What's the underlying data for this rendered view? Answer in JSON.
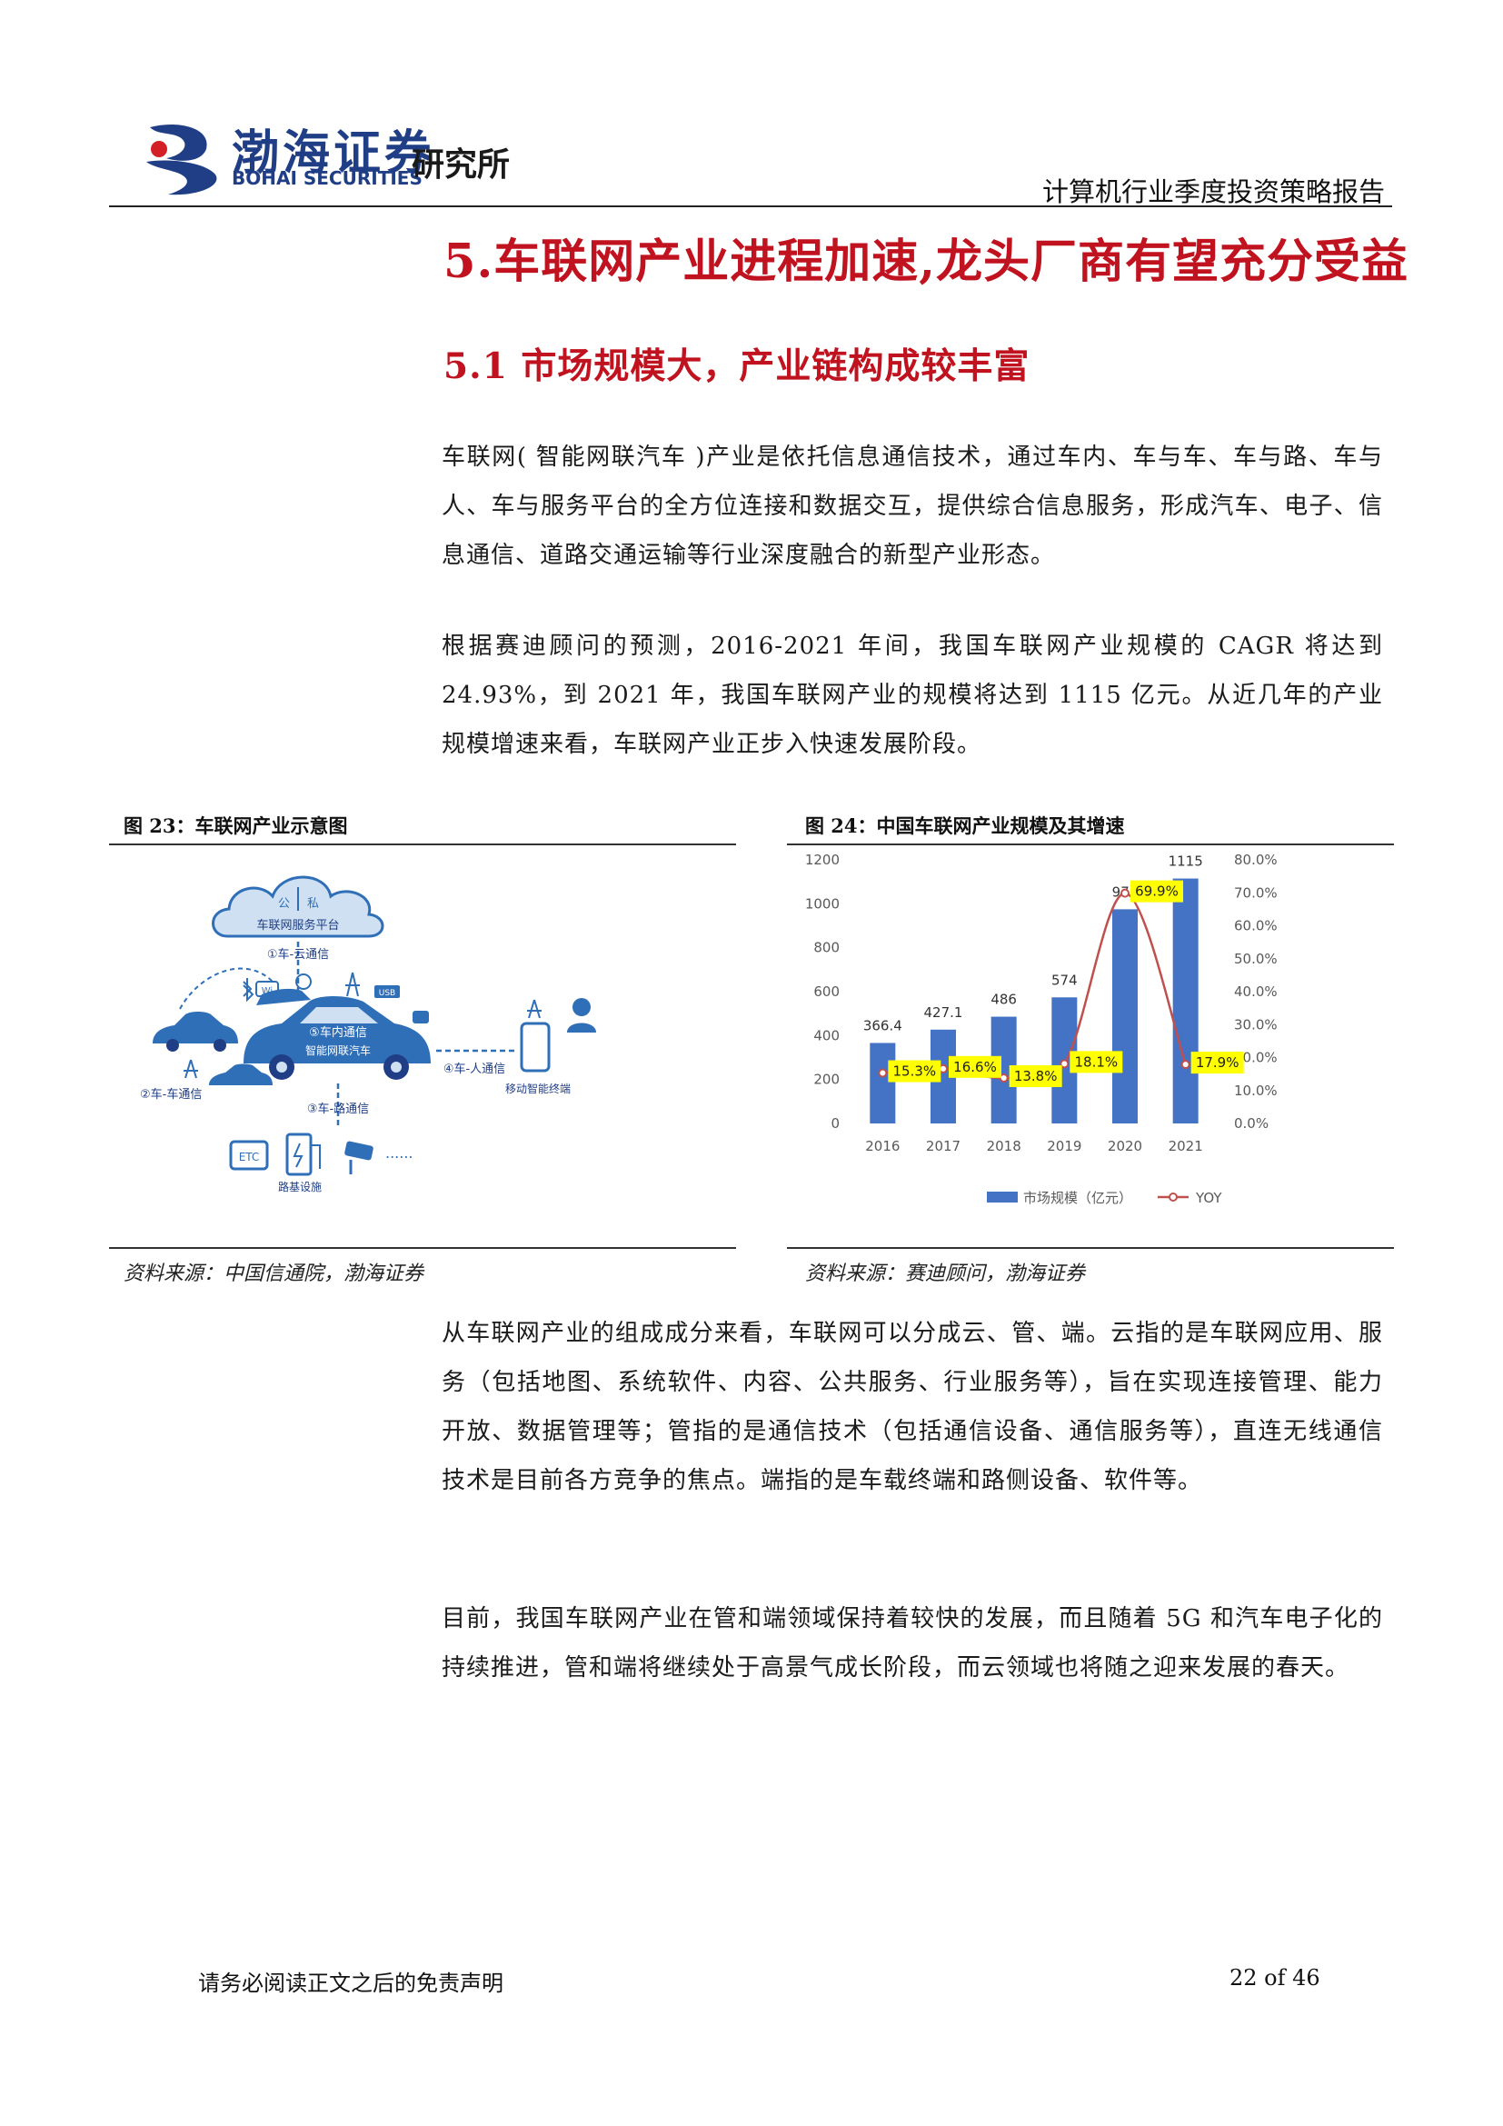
{
  "header": {
    "brand_cn": "渤海证券",
    "brand_en": "BOHAI SECURITIES",
    "brand_institute": "研究所",
    "report_title": "计算机行业季度投资策略报告"
  },
  "section": {
    "heading": "5.车联网产业进程加速,龙头厂商有望充分受益",
    "subheading": "5.1 市场规模大，产业链构成较丰富"
  },
  "paragraphs": {
    "p1": "车联网( 智能网联汽车 )产业是依托信息通信技术，通过车内、车与车、车与路、车与人、车与服务平台的全方位连接和数据交互，提供综合信息服务，形成汽车、电子、信息通信、道路交通运输等行业深度融合的新型产业形态。",
    "p2": "根据赛迪顾问的预测，2016-2021 年间，我国车联网产业规模的 CAGR 将达到 24.93%，到 2021 年，我国车联网产业的规模将达到 1115 亿元。从近几年的产业规模增速来看，车联网产业正步入快速发展阶段。",
    "p3": "从车联网产业的组成成分来看，车联网可以分成云、管、端。云指的是车联网应用、服务（包括地图、系统软件、内容、公共服务、行业服务等），旨在实现连接管理、能力开放、数据管理等；管指的是通信技术（包括通信设备、通信服务等），直连无线通信技术是目前各方竞争的焦点。端指的是车载终端和路侧设备、软件等。",
    "p4": "目前，我国车联网产业在管和端领域保持着较快的发展，而且随着 5G 和汽车电子化的持续推进，管和端将继续处于高景气成长阶段，而云领域也将随之迎来发展的春天。"
  },
  "fig23": {
    "title": "图 23：车联网产业示意图",
    "source": "资料来源：中国信通院，渤海证券",
    "labels": {
      "cloud_public": "公",
      "cloud_private": "私",
      "cloud_platform": "车联网服务平台",
      "link_cloud": "①车-云通信",
      "link_car": "②车-车通信",
      "link_road": "③车-路通信",
      "link_person": "④车-人通信",
      "link_inner": "⑤车内通信",
      "car_label": "智能网联汽车",
      "terminal_label": "移动智能终端",
      "road_label": "路基设施",
      "etc_label": "ETC",
      "wifi_label": "Wi",
      "usb_label": "USB"
    },
    "colors": {
      "primary": "#2f6fb8",
      "light": "#cfe0f2"
    }
  },
  "fig24": {
    "title": "图 24：中国车联网产业规模及其增速",
    "source": "资料来源：赛迪顾问，渤海证券",
    "colors": {
      "bar": "#4472c4",
      "line": "#c0504d",
      "label_bg": "#ffff00",
      "grid": "#d9d9d9",
      "axis_text": "#595959"
    }
  },
  "chart_data": {
    "type": "bar",
    "title": "",
    "categories": [
      "2016",
      "2017",
      "2018",
      "2019",
      "2020",
      "2021"
    ],
    "series": [
      {
        "name": "市场规模（亿元）",
        "type": "bar",
        "axis": "left",
        "values": [
          366.4,
          427.1,
          486,
          574,
          975,
          1115
        ]
      },
      {
        "name": "YOY",
        "type": "line",
        "axis": "right",
        "values": [
          15.3,
          16.6,
          13.8,
          18.1,
          69.9,
          17.9
        ]
      }
    ],
    "data_labels": {
      "bar": [
        "366.4",
        "427.1",
        "486",
        "574",
        "975",
        "1115"
      ],
      "line": [
        "15.3%",
        "16.6%",
        "13.8%",
        "18.1%",
        "69.9%",
        "17.9%"
      ]
    },
    "y_left": {
      "min": 0,
      "max": 1200,
      "ticks": [
        "0",
        "200",
        "400",
        "600",
        "800",
        "1000",
        "1200"
      ]
    },
    "y_right": {
      "min": 0,
      "max": 80,
      "ticks": [
        "0.0%",
        "10.0%",
        "20.0%",
        "30.0%",
        "40.0%",
        "50.0%",
        "60.0%",
        "70.0%",
        "80.0%"
      ]
    },
    "xlabel": "",
    "ylabel": "",
    "legend": {
      "position": "bottom",
      "items": [
        "市场规模（亿元）",
        "YOY"
      ]
    },
    "grid": false
  },
  "footer": {
    "disclaimer": "请务必阅读正文之后的免责声明",
    "page": "22 of 46"
  }
}
